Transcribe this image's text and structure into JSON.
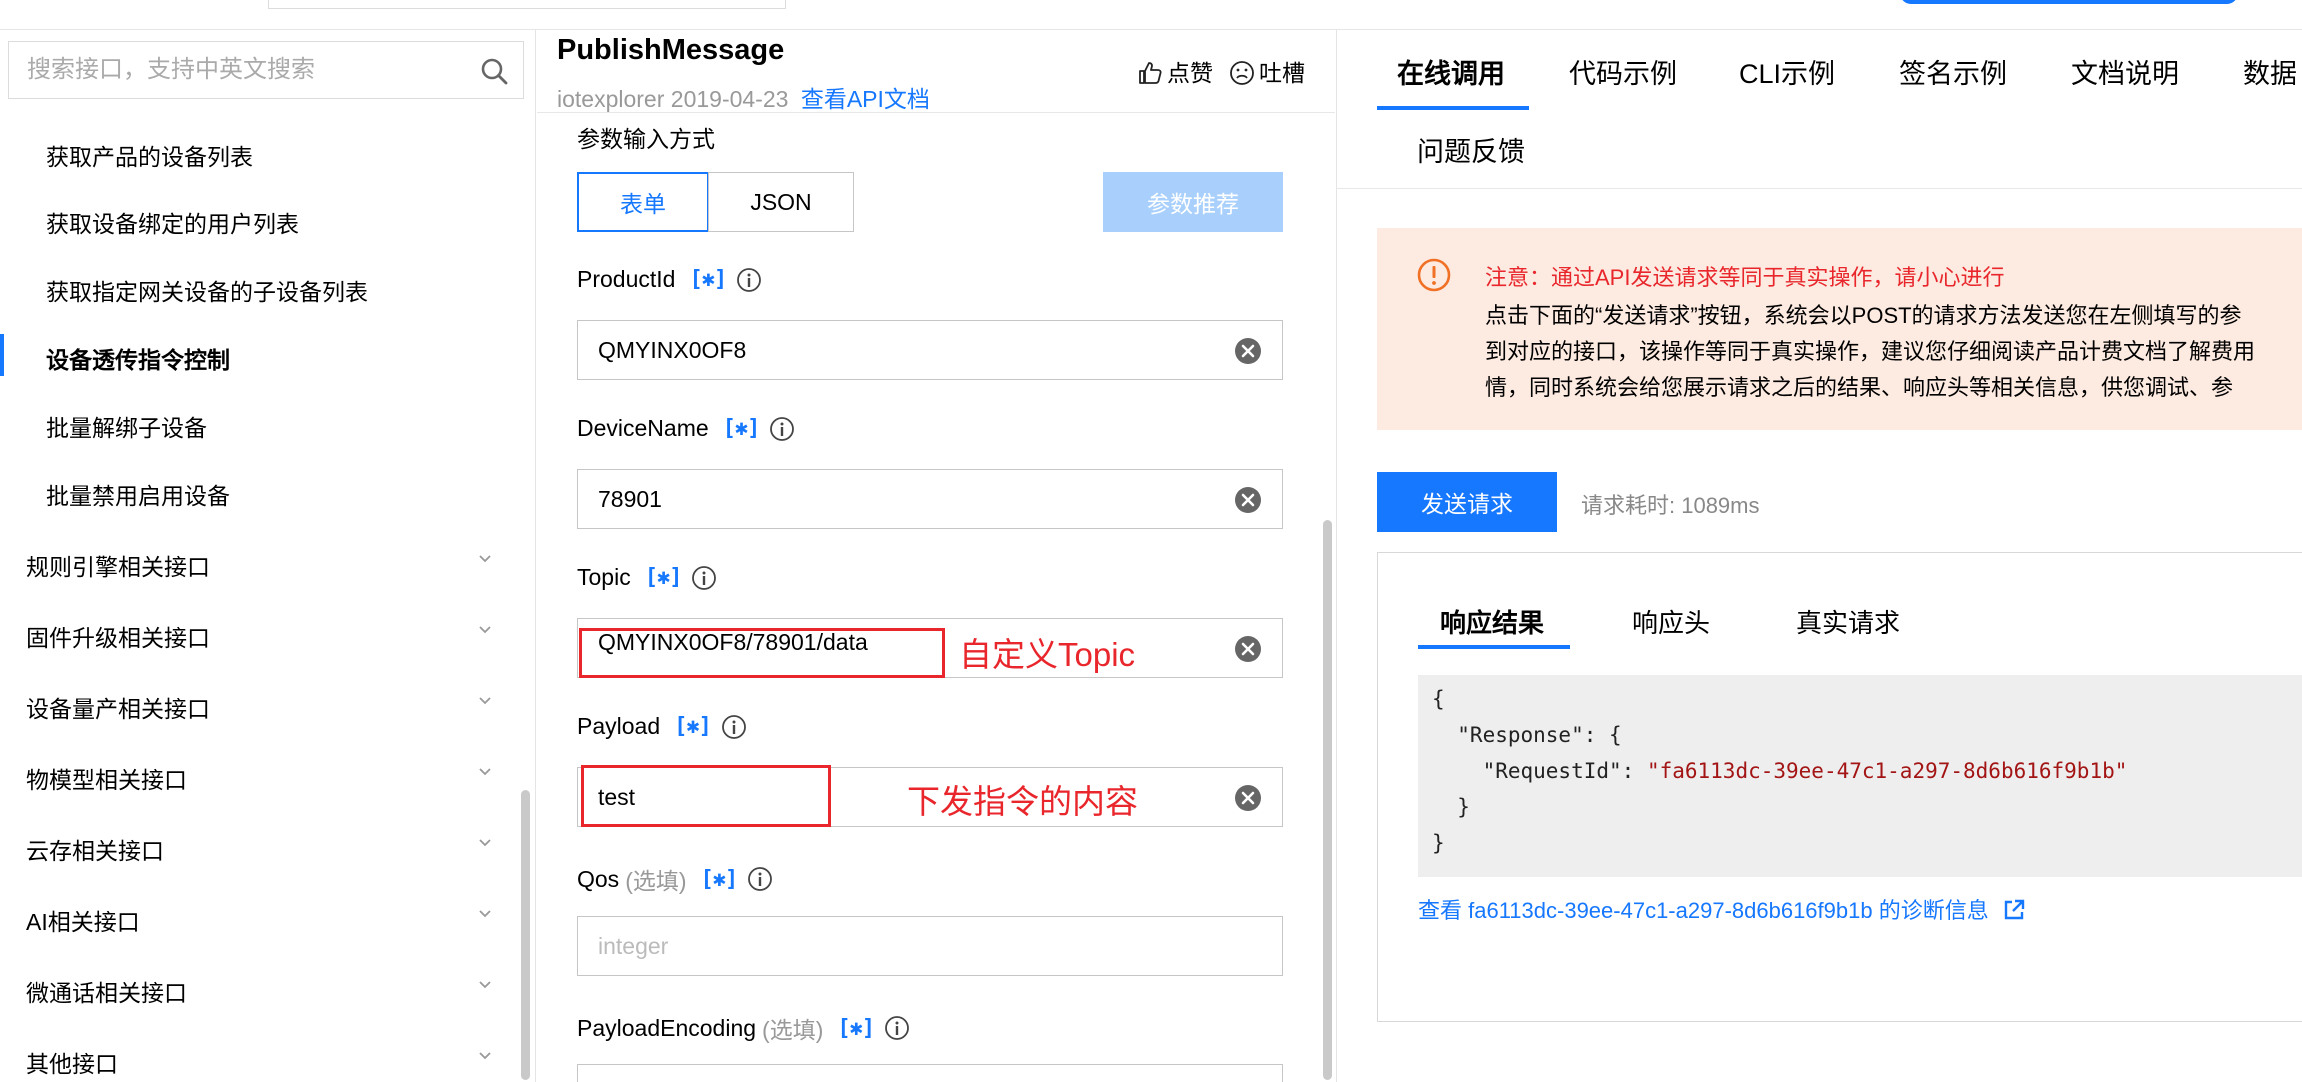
{
  "sidebar": {
    "search_placeholder": "搜索接口，支持中英文搜索",
    "sub_items": [
      {
        "label": "获取产品的设备列表"
      },
      {
        "label": "获取设备绑定的用户列表"
      },
      {
        "label": "获取指定网关设备的子设备列表"
      },
      {
        "label": "设备透传指令控制",
        "active": true
      },
      {
        "label": "批量解绑子设备"
      },
      {
        "label": "批量禁用启用设备"
      }
    ],
    "groups": [
      {
        "label": "规则引擎相关接口"
      },
      {
        "label": "固件升级相关接口"
      },
      {
        "label": "设备量产相关接口"
      },
      {
        "label": "物模型相关接口"
      },
      {
        "label": "云存相关接口"
      },
      {
        "label": "AI相关接口"
      },
      {
        "label": "微通话相关接口"
      },
      {
        "label": "其他接口"
      }
    ]
  },
  "api": {
    "name": "PublishMessage",
    "meta": "iotexplorer 2019-04-23",
    "doc_link": "查看API文档",
    "like": "点赞",
    "complain": "吐槽"
  },
  "form": {
    "input_mode_label": "参数输入方式",
    "mode_form": "表单",
    "mode_json": "JSON",
    "recommend": "参数推荐",
    "required_badge": "[✱]",
    "fields": [
      {
        "name": "ProductId",
        "optional": "",
        "value": "QMYINX0OF8",
        "placeholder": ""
      },
      {
        "name": "DeviceName",
        "optional": "",
        "value": "78901",
        "placeholder": ""
      },
      {
        "name": "Topic",
        "optional": "",
        "value": "QMYINX0OF8/78901/data",
        "placeholder": ""
      },
      {
        "name": "Payload",
        "optional": "",
        "value": "test",
        "placeholder": ""
      },
      {
        "name": "Qos",
        "optional": "(选填)",
        "value": "",
        "placeholder": "integer"
      },
      {
        "name": "PayloadEncoding",
        "optional": "(选填)",
        "value": "",
        "placeholder": ""
      }
    ],
    "annotations": {
      "topic_note": "自定义Topic",
      "payload_note": "下发指令的内容"
    }
  },
  "right": {
    "tabs": [
      "在线调用",
      "代码示例",
      "CLI示例",
      "签名示例",
      "文档说明",
      "数据",
      "问题反馈"
    ],
    "warning": {
      "title": "注意：通过API发送请求等同于真实操作，请小心进行",
      "lines": [
        "点击下面的“发送请求”按钮，系统会以POST的请求方法发送您在左侧填写的参",
        "到对应的接口，该操作等同于真实操作，建议您仔细阅读产品计费文档了解费用",
        "情，同时系统会给您展示请求之后的结果、响应头等相关信息，供您调试、参"
      ]
    },
    "send_button": "发送请求",
    "elapsed": "请求耗时: 1089ms",
    "response_tabs": [
      "响应结果",
      "响应头",
      "真实请求"
    ],
    "response_code": {
      "l1": "{",
      "l2_key": "  \"Response\": {",
      "l3_key": "    \"RequestId\": ",
      "l3_val": "\"fa6113dc-39ee-47c1-a297-8d6b616f9b1b\"",
      "l4": "  }",
      "l5": "}"
    },
    "diagnosis_link": "查看 fa6113dc-39ee-47c1-a297-8d6b616f9b1b 的诊断信息"
  },
  "colors": {
    "accent": "#1677ff",
    "annotation_red": "#e8262b",
    "warning_bg": "#fdeae0",
    "recommend_disabled": "#a9d0fc"
  }
}
